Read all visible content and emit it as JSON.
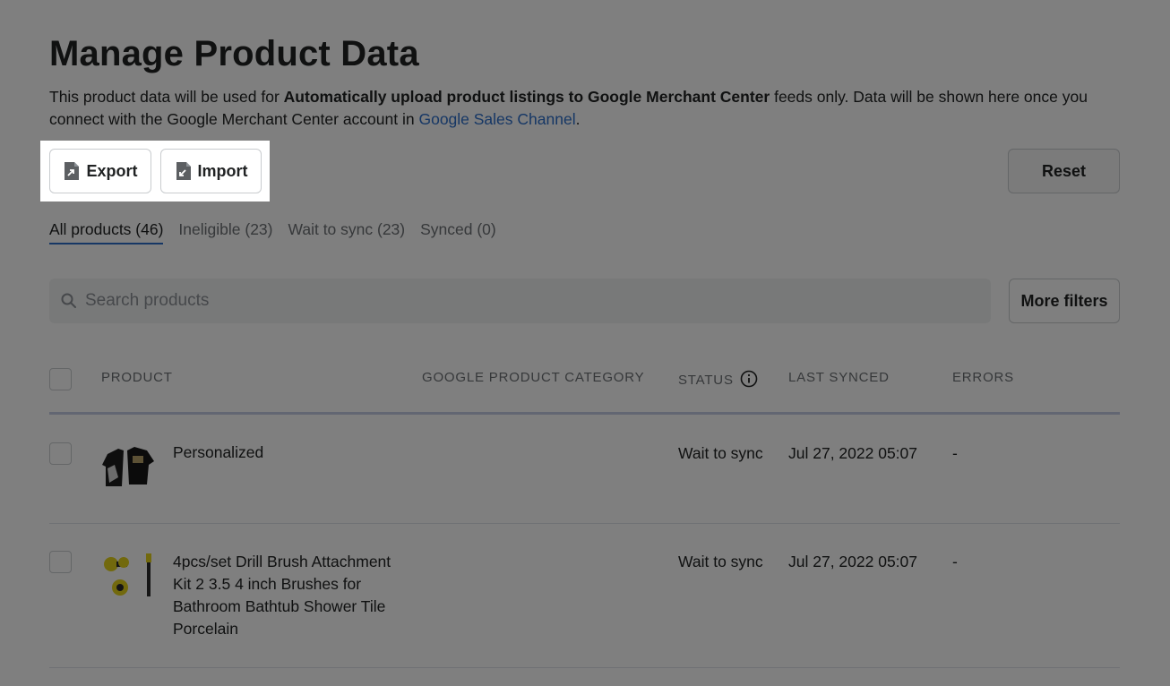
{
  "header": {
    "title": "Manage Product Data",
    "desc_pre": "This product data will be used for ",
    "desc_bold": "Automatically upload product listings to Google Merchant Center",
    "desc_post": " feeds only. Data will be shown here once you connect with the Google Merchant Center account in ",
    "desc_link": "Google Sales Channel",
    "desc_end": "."
  },
  "toolbar": {
    "export_label": "Export",
    "import_label": "Import",
    "reset_label": "Reset"
  },
  "tabs": [
    {
      "label": "All products (46)"
    },
    {
      "label": "Ineligible (23)"
    },
    {
      "label": "Wait to sync (23)"
    },
    {
      "label": "Synced (0)"
    }
  ],
  "search": {
    "placeholder": "Search products",
    "more_filters_label": "More filters"
  },
  "table": {
    "columns": [
      "PRODUCT",
      "GOOGLE PRODUCT CATEGORY",
      "STATUS",
      "LAST SYNCED",
      "ERRORS"
    ],
    "rows": [
      {
        "product": "Personalized",
        "category": "",
        "status": "Wait to sync",
        "last_synced": "Jul 27, 2022 05:07",
        "errors": "-"
      },
      {
        "product_lines": [
          "4pcs/set Drill Brush Attachment",
          "Kit 2 3.5 4 inch Brushes for",
          "Bathroom Bathtub Shower Tile",
          "Porcelain"
        ],
        "category": "",
        "status": "Wait to sync",
        "last_synced": "Jul 27, 2022 05:07",
        "errors": "-"
      }
    ]
  },
  "colors": {
    "accent": "#2c6ecb",
    "overlay": "rgba(0,0,0,0.5)"
  }
}
